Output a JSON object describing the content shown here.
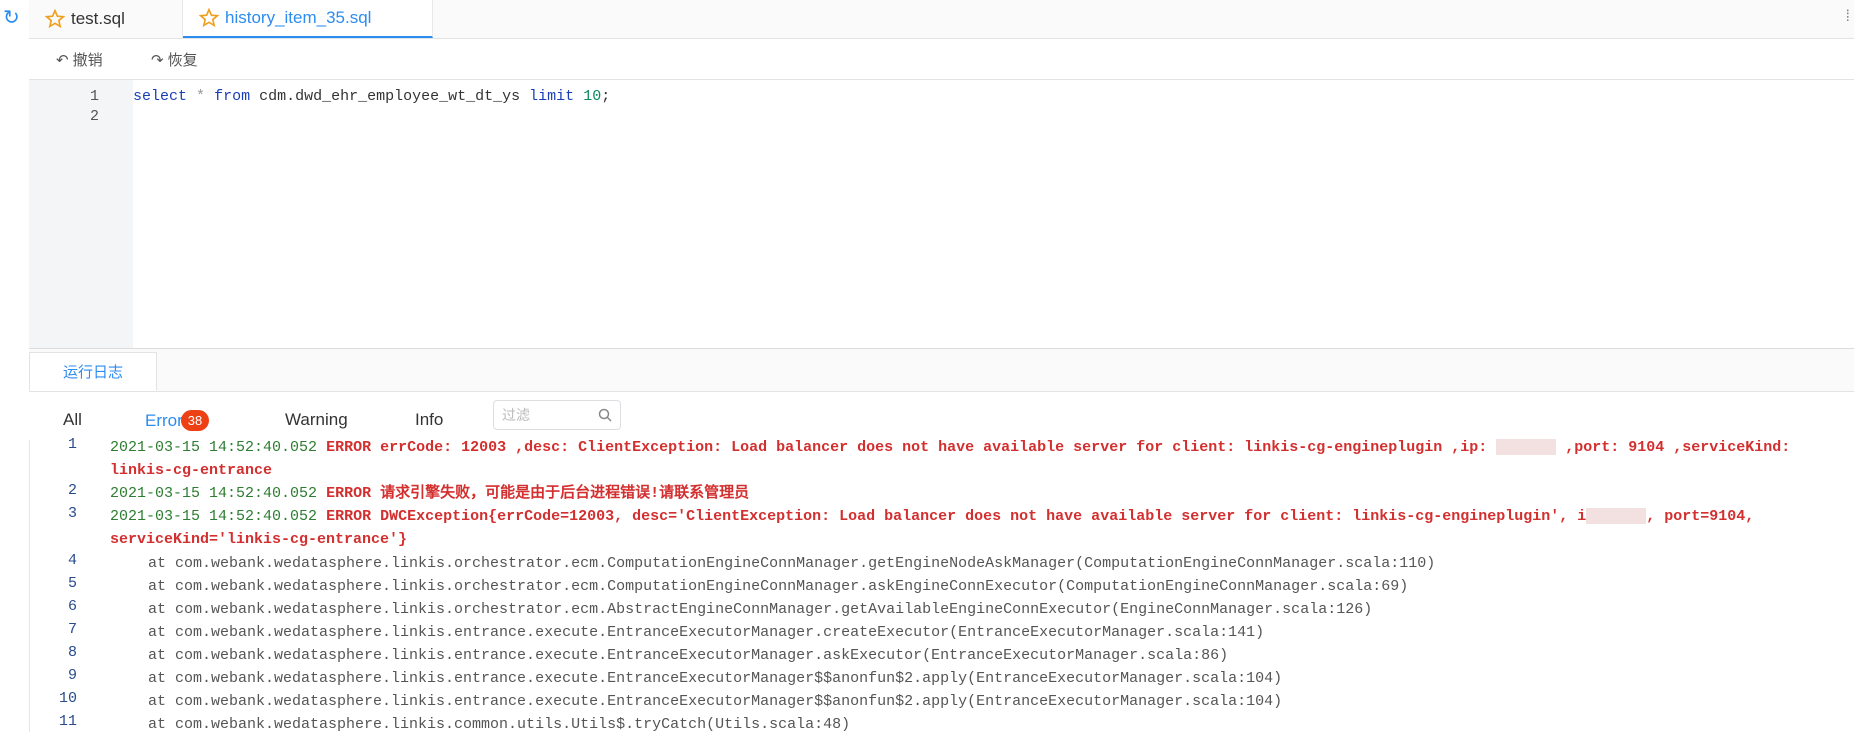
{
  "tabs": [
    {
      "label": "test.sql",
      "icon": "star-icon"
    },
    {
      "label": "history_item_35.sql",
      "icon": "star-icon"
    }
  ],
  "toolbar": {
    "undo_label": "撤销",
    "redo_label": "恢复"
  },
  "editor": {
    "lines": [
      "1",
      "2"
    ],
    "code": {
      "kw_select": "select",
      "star": "*",
      "kw_from": "from",
      "table": "cdm.dwd_ehr_employee_wt_dt_ys",
      "kw_limit": "limit",
      "limit_value": "10",
      "end": ";"
    }
  },
  "log_panel": {
    "tab_label": "运行日志",
    "filters": {
      "all": "All",
      "error": "Error",
      "error_count": "38",
      "warning": "Warning",
      "info": "Info"
    },
    "search_placeholder": "过滤",
    "rows": [
      {
        "n": "1",
        "ts": "2021-03-15 14:52:40.052",
        "msg": "ERROR errCode: 12003 ,desc: ClientException: Load balancer does not have available server for client: linkis-cg-engineplugin ,ip: ",
        "msg2": " ,port: 9104 ,serviceKind: linkis-cg-entrance"
      },
      {
        "n": "2",
        "ts": "2021-03-15 14:52:40.052",
        "msg": "ERROR 请求引擎失败，可能是由于后台进程错误!请联系管理员"
      },
      {
        "n": "3",
        "ts": "2021-03-15 14:52:40.052",
        "msg": "ERROR DWCException{errCode=12003, desc='ClientException: Load balancer does not have available server for client: linkis-cg-engineplugin', i",
        "msg2": ", port=9104, serviceKind='linkis-cg-entrance'}"
      },
      {
        "n": "4",
        "msg": "at com.webank.wedatasphere.linkis.orchestrator.ecm.ComputationEngineConnManager.getEngineNodeAskManager(ComputationEngineConnManager.scala:110)"
      },
      {
        "n": "5",
        "msg": "at com.webank.wedatasphere.linkis.orchestrator.ecm.ComputationEngineConnManager.askEngineConnExecutor(ComputationEngineConnManager.scala:69)"
      },
      {
        "n": "6",
        "msg": "at com.webank.wedatasphere.linkis.orchestrator.ecm.AbstractEngineConnManager.getAvailableEngineConnExecutor(EngineConnManager.scala:126)"
      },
      {
        "n": "7",
        "msg": "at com.webank.wedatasphere.linkis.entrance.execute.EntranceExecutorManager.createExecutor(EntranceExecutorManager.scala:141)"
      },
      {
        "n": "8",
        "msg": "at com.webank.wedatasphere.linkis.entrance.execute.EntranceExecutorManager.askExecutor(EntranceExecutorManager.scala:86)"
      },
      {
        "n": "9",
        "msg": "at com.webank.wedatasphere.linkis.entrance.execute.EntranceExecutorManager$$anonfun$2.apply(EntranceExecutorManager.scala:104)"
      },
      {
        "n": "10",
        "msg": "at com.webank.wedatasphere.linkis.entrance.execute.EntranceExecutorManager$$anonfun$2.apply(EntranceExecutorManager.scala:104)"
      },
      {
        "n": "11",
        "msg": "at com.webank.wedatasphere.linkis.common.utils.Utils$.tryCatch(Utils.scala:48)"
      }
    ]
  }
}
